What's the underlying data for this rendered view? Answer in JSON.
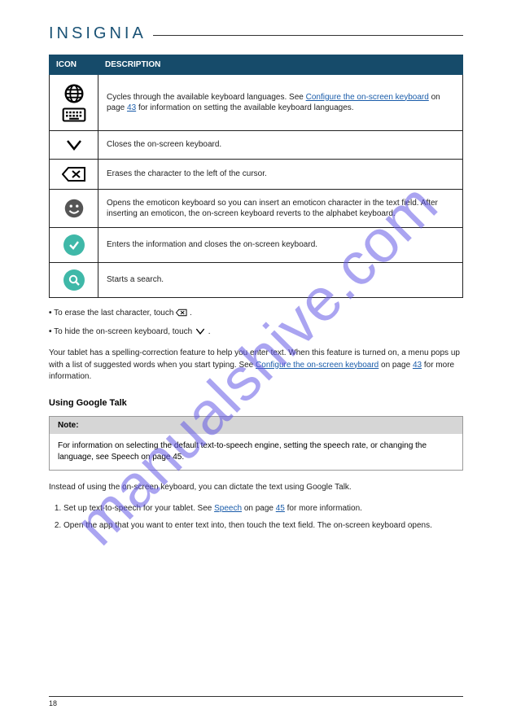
{
  "brand": "INSIGNIA",
  "watermark": "manualshive.com",
  "table": {
    "head_icon": "ICON",
    "head_desc": "DESCRIPTION",
    "row_lang": {
      "pre": "Cycles through the available keyboard languages. See ",
      "link": "Configure the on-screen keyboard",
      "post": " on page ",
      "pg": "43",
      "post2": " for information on setting the available keyboard languages."
    },
    "row_close": "Closes the on-screen keyboard.",
    "row_back": "Erases the character to the left of the cursor.",
    "row_emoji": "Opens the emoticon keyboard so you can insert an emoticon character in the text field. After inserting an emoticon, the on-screen keyboard reverts to the alphabet keyboard.",
    "row_enter": "Enters the information and closes the on-screen keyboard.",
    "row_search": "Starts a search."
  },
  "usage": {
    "bullet": "•",
    "line1_pre": "To erase the last character, touch ",
    "line1_post": ".",
    "line2_pre": "To hide the on-screen keyboard, touch ",
    "line2_post": ".",
    "line3": "Your tablet has a spelling-correction feature to help you enter text. When this feature is turned on, a menu pops up with a list of suggested words when you start typing. See ",
    "line3_link": "Configure the on-screen keyboard",
    "line3_post": " on page ",
    "line3_pg": "43",
    "line3_post2": " for more information."
  },
  "talk": {
    "heading": "Using Google Talk",
    "note_head": "Note:",
    "note_body": "For information on selecting the default text-to-speech engine, setting the speech rate, or changing the language, see Speech on page 45.",
    "intro": "Instead of using the on-screen keyboard, you can dictate the text using Google Talk.",
    "steps": [
      {
        "pre": "Set up text-to-speech for your tablet. See ",
        "link": "Speech",
        "post": " on page ",
        "pg": "45",
        "post2": " for more information."
      },
      {
        "pre": "Open the app that you want to enter text into, then touch the text field. The on-screen keyboard opens.",
        "link": "",
        "post": "",
        "pg": "",
        "post2": ""
      }
    ]
  },
  "page_number": "18"
}
